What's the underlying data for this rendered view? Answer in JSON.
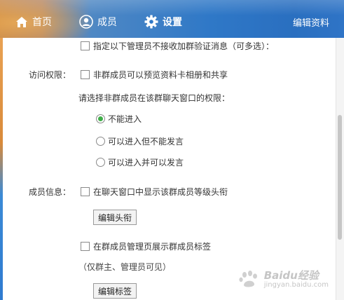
{
  "nav": {
    "home_label": "首页",
    "members_label": "成员",
    "settings_label": "设置",
    "edit_profile_label": "编辑资料"
  },
  "settings": {
    "admin_no_verify_label": "指定以下管理员不接收加群验证消息（可多选）：",
    "access_section_label": "访问权限：",
    "nonmember_preview_label": "非群成员可以预览资料卡相册和共享",
    "nonmember_chat_prompt": "请选择非群成员在该群聊天窗口的权限：",
    "chat_permission_options": [
      {
        "label": "不能进入",
        "checked": true
      },
      {
        "label": "可以进入但不能发言",
        "checked": false
      },
      {
        "label": "可以进入并可以发言",
        "checked": false
      }
    ],
    "member_info_section_label": "成员信息：",
    "show_level_title_label": "在聊天窗口中显示该群成员等级头衔",
    "edit_title_button": "编辑头衔",
    "show_member_tags_label": "在群成员管理页展示群成员标签",
    "tags_visibility_note": "（仅群主、管理员可见）",
    "edit_tags_button": "编辑标签"
  },
  "watermark": {
    "brand": "Baidu经验",
    "url": "jingyan.baidu.com"
  },
  "colors": {
    "nav_blue": "#2f78c7",
    "nav_orange": "#c98a4a",
    "radio_checked": "#3fae49"
  }
}
